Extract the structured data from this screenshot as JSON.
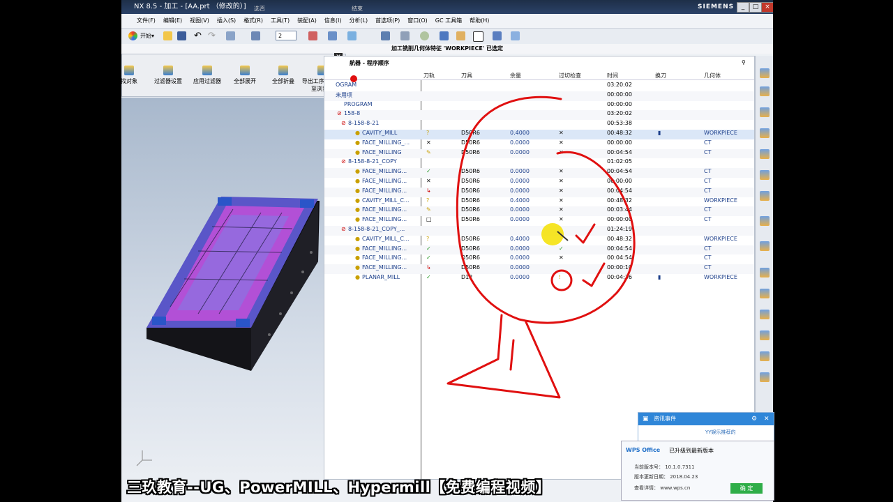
{
  "window": {
    "title": "NX 8.5 - 加工 - [AA.prt （修改的）]",
    "mid_tabs": [
      "选否",
      "结束"
    ],
    "brand": "SIEMENS",
    "controls": [
      "_",
      "□",
      "×"
    ]
  },
  "menu": [
    "文件(F)",
    "编辑(E)",
    "视图(V)",
    "插入(S)",
    "格式(R)",
    "工具(T)",
    "装配(A)",
    "信息(I)",
    "分析(L)",
    "首选项(P)",
    "窗口(O)",
    "GC 工具箱",
    "帮助(H)"
  ],
  "toolbar": {
    "start_label": "开始▾",
    "selector_value": "2"
  },
  "status": "加工铣削几何体特征 'WORKPIECE' 已选定",
  "filter_panel": {
    "buttons": [
      "找对象",
      "过滤器设置",
      "应用过滤器",
      "全部展开",
      "全部折叠",
      "导出工序导航 树至浏览器"
    ]
  },
  "navigator": {
    "title": "航器 - 程序顺序",
    "columns": [
      "刀轨",
      "刀具",
      "余量",
      "过切检查",
      "时间",
      "换刀",
      "几何体"
    ],
    "rows": [
      {
        "name": "OGRAM",
        "path": "",
        "tool": "",
        "stock": "",
        "gouge": "",
        "time": "03:20:02",
        "change": "",
        "geom": ""
      },
      {
        "name": "未用项",
        "path": "",
        "tool": "",
        "stock": "",
        "gouge": "",
        "time": "00:00:00",
        "change": "",
        "geom": ""
      },
      {
        "name": "PROGRAM",
        "path": "",
        "tool": "",
        "stock": "",
        "gouge": "",
        "time": "00:00:00",
        "change": "",
        "geom": ""
      },
      {
        "name": "158-8",
        "path": "",
        "tool": "",
        "stock": "",
        "gouge": "",
        "time": "03:20:02",
        "change": "",
        "geom": ""
      },
      {
        "name": "8-158-8-21",
        "path": "",
        "tool": "",
        "stock": "",
        "gouge": "",
        "time": "00:53:38",
        "change": "",
        "geom": ""
      },
      {
        "name": "CAVITY_MILL",
        "path": "?",
        "tool": "D50R6",
        "stock": "0.4000",
        "gouge": "✕",
        "time": "00:48:32",
        "change": "▮",
        "geom": "WORKPIECE"
      },
      {
        "name": "FACE_MILLING_...",
        "path": "✕",
        "tool": "D50R6",
        "stock": "0.0000",
        "gouge": "✕",
        "time": "00:00:00",
        "change": "",
        "geom": "CT"
      },
      {
        "name": "FACE_MILLING",
        "path": "✎",
        "tool": "D50R6",
        "stock": "0.0000",
        "gouge": "✕",
        "time": "00:04:54",
        "change": "",
        "geom": "CT"
      },
      {
        "name": "8-158-8-21_COPY",
        "path": "",
        "tool": "",
        "stock": "",
        "gouge": "",
        "time": "01:02:05",
        "change": "",
        "geom": ""
      },
      {
        "name": "FACE_MILLING...",
        "path": "✓",
        "tool": "D50R6",
        "stock": "0.0000",
        "gouge": "✕",
        "time": "00:04:54",
        "change": "",
        "geom": "CT"
      },
      {
        "name": "FACE_MILLING...",
        "path": "✕",
        "tool": "D50R6",
        "stock": "0.0000",
        "gouge": "✕",
        "time": "00:00:00",
        "change": "",
        "geom": "CT"
      },
      {
        "name": "FACE_MILLING...",
        "path": "↳",
        "tool": "D50R6",
        "stock": "0.0000",
        "gouge": "✕",
        "time": "00:04:54",
        "change": "",
        "geom": "CT"
      },
      {
        "name": "CAVITY_MILL_C...",
        "path": "?",
        "tool": "D50R6",
        "stock": "0.4000",
        "gouge": "✕",
        "time": "00:48:32",
        "change": "",
        "geom": "WORKPIECE"
      },
      {
        "name": "FACE_MILLING...",
        "path": "✎",
        "tool": "D50R6",
        "stock": "0.0000",
        "gouge": "✕",
        "time": "00:03:44",
        "change": "",
        "geom": "CT"
      },
      {
        "name": "FACE_MILLING...",
        "path": "□",
        "tool": "D50R6",
        "stock": "0.0000",
        "gouge": "✕",
        "time": "00:00:00",
        "change": "",
        "geom": "CT"
      },
      {
        "name": "8-158-8-21_COPY_...",
        "path": "",
        "tool": "",
        "stock": "",
        "gouge": "",
        "time": "01:24:19",
        "change": "",
        "geom": ""
      },
      {
        "name": "CAVITY_MILL_C...",
        "path": "?",
        "tool": "D50R6",
        "stock": "0.4000",
        "gouge": "",
        "time": "00:48:32",
        "change": "",
        "geom": "WORKPIECE"
      },
      {
        "name": "FACE_MILLING...",
        "path": "✓",
        "tool": "D50R6",
        "stock": "0.0000",
        "gouge": "✓",
        "time": "00:04:54",
        "change": "",
        "geom": "CT"
      },
      {
        "name": "FACE_MILLING...",
        "path": "✓",
        "tool": "D50R6",
        "stock": "0.0000",
        "gouge": "✕",
        "time": "00:04:54",
        "change": "",
        "geom": "CT"
      },
      {
        "name": "FACE_MILLING...",
        "path": "↳",
        "tool": "D50R6",
        "stock": "0.0000",
        "gouge": "",
        "time": "00:00:10",
        "change": "",
        "geom": "CT"
      },
      {
        "name": "PLANAR_MILL",
        "path": "✓",
        "tool": "D12",
        "stock": "0.0000",
        "gouge": "!",
        "time": "00:04:36",
        "change": "▮",
        "geom": "WORKPIECE"
      }
    ]
  },
  "popup_news": {
    "title": "资讯事件",
    "sub": "YY娱乐推荐的"
  },
  "popup_wps": {
    "logo": "WPS Office",
    "message": "已升级到最新版本",
    "version_line": "当前版本号： 10.1.0.7311",
    "date_line": "版本更新日期： 2018.04.23",
    "site_line": "查看详情： www.wps.cn",
    "ok_label": "确 定"
  },
  "caption": "三玖教育--UG、PowerMILL、Hypermill【免费编程视频】",
  "colors": {
    "annotation": "#e01010",
    "titlebar": "#1e2f48",
    "accent": "#2f86d8"
  }
}
